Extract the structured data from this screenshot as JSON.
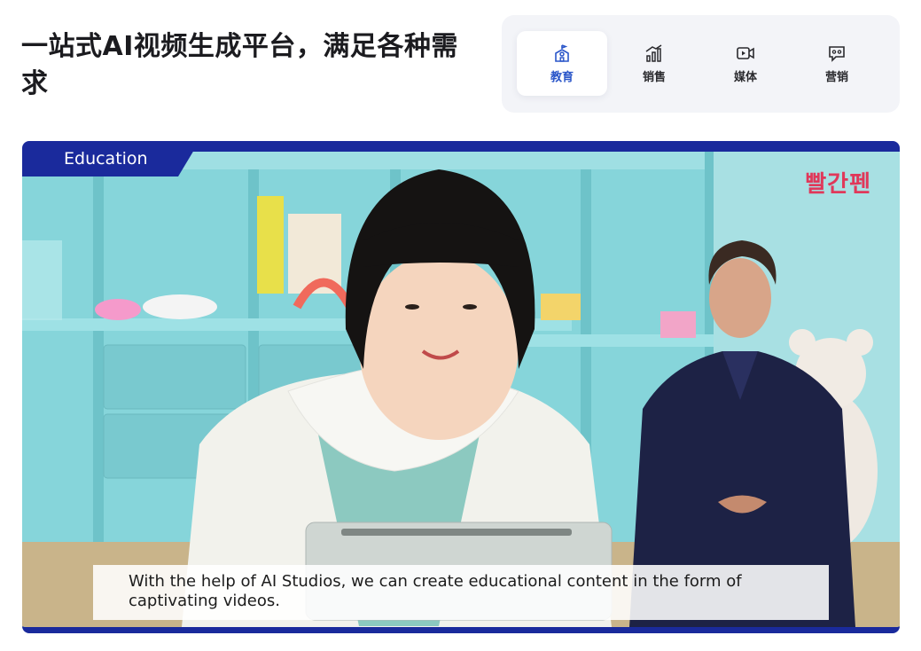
{
  "headline": "一站式AI视频生成平台，满足各种需求",
  "tabs": [
    {
      "label": "教育",
      "icon": "school-icon",
      "active": true
    },
    {
      "label": "销售",
      "icon": "bar-chart-icon",
      "active": false
    },
    {
      "label": "媒体",
      "icon": "video-camera-icon",
      "active": false
    },
    {
      "label": "营销",
      "icon": "chat-bubble-icon",
      "active": false
    }
  ],
  "video": {
    "category_badge": "Education",
    "brand_logo": "빨간펜",
    "caption": "With the help of AI Studios, we can create educational content in the form of captivating videos."
  },
  "colors": {
    "accent_blue": "#2a56c9",
    "frame_navy": "#1a2a9c",
    "brand_red": "#e0385a",
    "shelf_teal": "#7fd3d8"
  }
}
